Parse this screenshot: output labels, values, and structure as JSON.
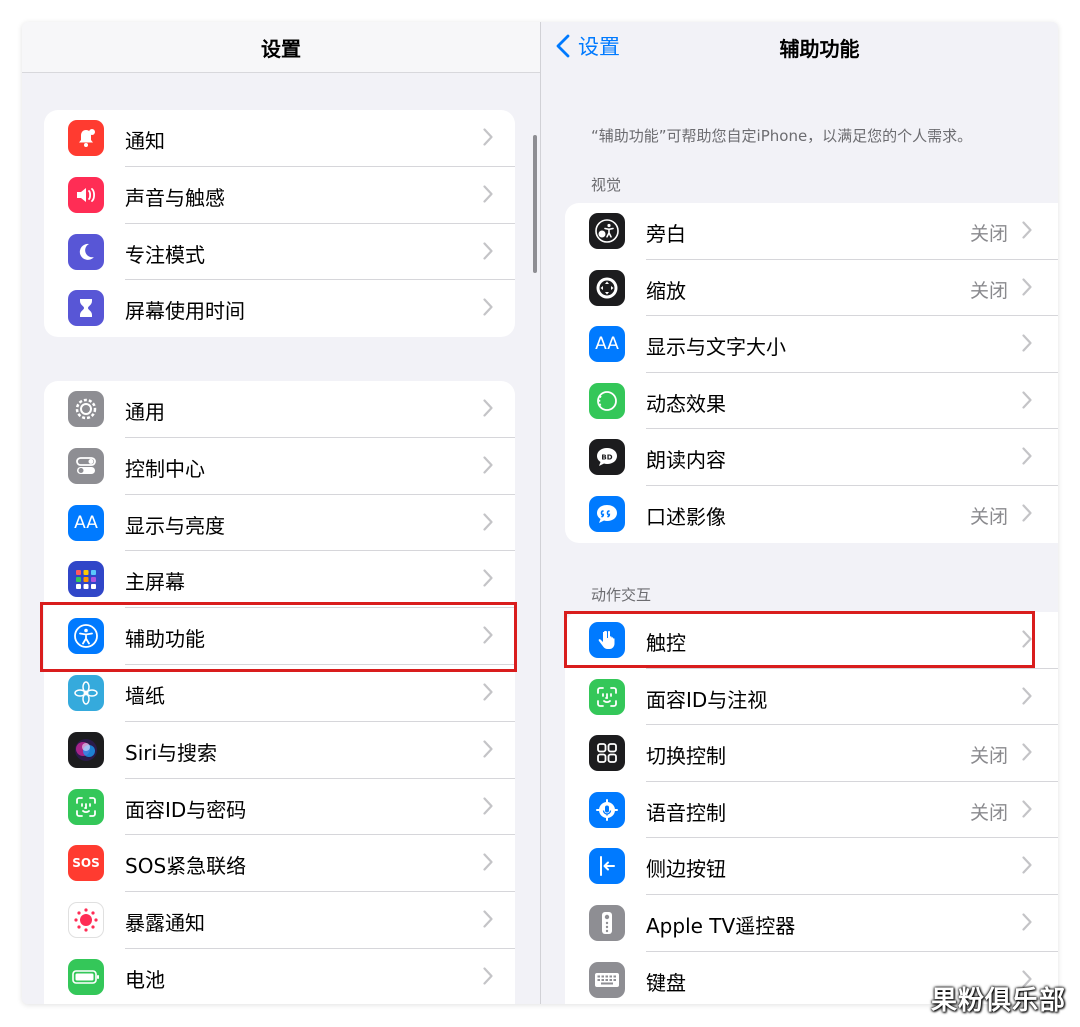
{
  "left": {
    "title": "设置",
    "group1": [
      {
        "label": "通知",
        "icon": "bell-icon",
        "color": "#ff3b30"
      },
      {
        "label": "声音与触感",
        "icon": "speaker-icon",
        "color": "#ff2d55"
      },
      {
        "label": "专注模式",
        "icon": "moon-icon",
        "color": "#5856d6"
      },
      {
        "label": "屏幕使用时间",
        "icon": "hourglass-icon",
        "color": "#5856d6"
      }
    ],
    "group2": [
      {
        "label": "通用",
        "icon": "gear-icon",
        "color": "#8e8e93"
      },
      {
        "label": "控制中心",
        "icon": "toggles-icon",
        "color": "#8e8e93"
      },
      {
        "label": "显示与亮度",
        "icon": "aa-icon",
        "color": "#007aff"
      },
      {
        "label": "主屏幕",
        "icon": "homescreen-grid-icon",
        "color": "#3046c8"
      },
      {
        "label": "辅助功能",
        "icon": "accessibility-icon",
        "color": "#007aff"
      },
      {
        "label": "墙纸",
        "icon": "flower-icon",
        "color": "#35aadc"
      },
      {
        "label": "Siri与搜索",
        "icon": "siri-icon",
        "color": "#1c1c1e"
      },
      {
        "label": "面容ID与密码",
        "icon": "faceid-icon",
        "color": "#34c759"
      },
      {
        "label": "SOS紧急联络",
        "icon": "sos-icon",
        "color": "#ff3b30"
      },
      {
        "label": "暴露通知",
        "icon": "exposure-icon",
        "color": "#ffffff"
      },
      {
        "label": "电池",
        "icon": "battery-icon",
        "color": "#34c759"
      }
    ]
  },
  "right": {
    "back_label": "设置",
    "title": "辅助功能",
    "description": "“辅助功能”可帮助您自定iPhone，以满足您的个人需求。",
    "vision_header": "视觉",
    "interaction_header": "动作交互",
    "vision": [
      {
        "label": "旁白",
        "value": "关闭",
        "icon": "voiceover-icon",
        "color": "#1c1c1e"
      },
      {
        "label": "缩放",
        "value": "关闭",
        "icon": "zoom-icon",
        "color": "#1c1c1e"
      },
      {
        "label": "显示与文字大小",
        "value": "",
        "icon": "aa-icon",
        "color": "#007aff"
      },
      {
        "label": "动态效果",
        "value": "",
        "icon": "motion-icon",
        "color": "#34c759"
      },
      {
        "label": "朗读内容",
        "value": "",
        "icon": "speech-bubble-icon",
        "color": "#1c1c1e"
      },
      {
        "label": "口述影像",
        "value": "关闭",
        "icon": "audio-description-icon",
        "color": "#007aff"
      }
    ],
    "interaction": [
      {
        "label": "触控",
        "value": "",
        "icon": "hand-touch-icon",
        "color": "#007aff"
      },
      {
        "label": "面容ID与注视",
        "value": "",
        "icon": "faceid-icon",
        "color": "#34c759"
      },
      {
        "label": "切换控制",
        "value": "关闭",
        "icon": "switch-grid-icon",
        "color": "#1c1c1e"
      },
      {
        "label": "语音控制",
        "value": "关闭",
        "icon": "voice-control-icon",
        "color": "#007aff"
      },
      {
        "label": "侧边按钮",
        "value": "",
        "icon": "side-button-icon",
        "color": "#007aff"
      },
      {
        "label": "Apple TV遥控器",
        "value": "",
        "icon": "remote-icon",
        "color": "#8e8e93"
      },
      {
        "label": "键盘",
        "value": "",
        "icon": "keyboard-icon",
        "color": "#8e8e93"
      }
    ]
  },
  "watermark": "果粉俱乐部",
  "colors": {
    "highlight": "#d91d1d",
    "link": "#007aff"
  }
}
